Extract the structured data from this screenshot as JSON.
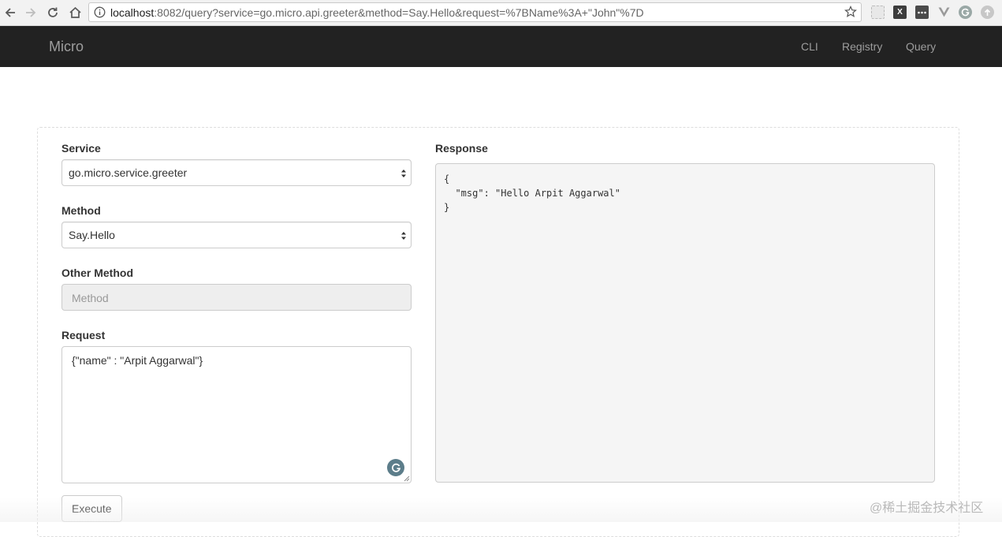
{
  "browser": {
    "url_host": "localhost",
    "url_rest": ":8082/query?service=go.micro.api.greeter&method=Say.Hello&request=%7BName%3A+\"John\"%7D",
    "ext_x": "X"
  },
  "navbar": {
    "brand": "Micro",
    "links": [
      "CLI",
      "Registry",
      "Query"
    ]
  },
  "form": {
    "service_label": "Service",
    "service_value": "go.micro.service.greeter",
    "method_label": "Method",
    "method_value": "Say.Hello",
    "other_method_label": "Other Method",
    "other_method_placeholder": "Method",
    "request_label": "Request",
    "request_value": "{\"name\" : \"Arpit Aggarwal\"}",
    "execute_label": "Execute"
  },
  "response": {
    "label": "Response",
    "body": "{\n  \"msg\": \"Hello Arpit Aggarwal\"\n}"
  },
  "watermark": "@稀土掘金技术社区",
  "colors": {
    "navbar_bg": "#222222",
    "navbar_text": "#9d9d9d",
    "pre_bg": "#f5f5f5"
  }
}
